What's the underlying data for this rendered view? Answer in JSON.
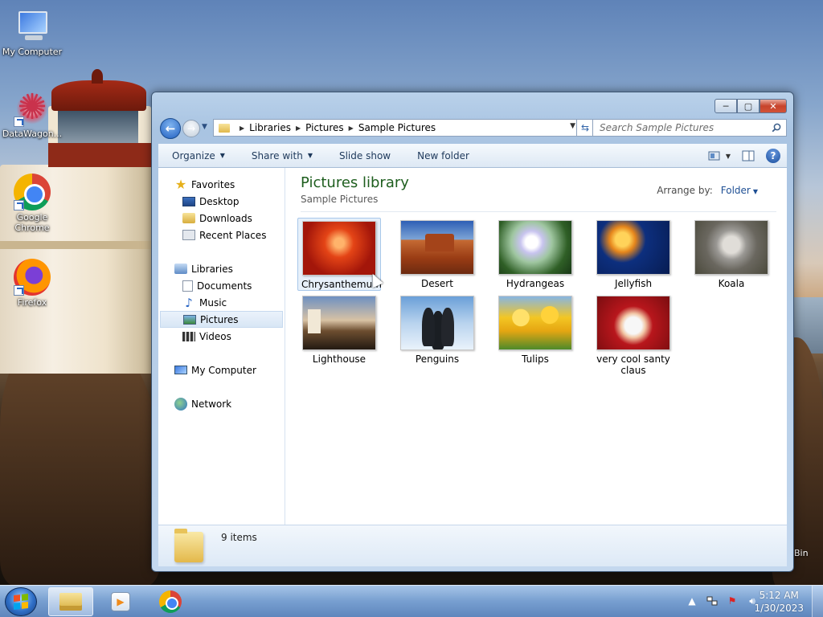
{
  "desktop": {
    "icons": [
      {
        "label": "My Computer",
        "icon": "computer-icon"
      },
      {
        "label": "DataWagon...",
        "icon": "datawagon-icon"
      },
      {
        "label": "Google Chrome",
        "icon": "chrome-icon"
      },
      {
        "label": "Firefox",
        "icon": "firefox-icon"
      }
    ],
    "partial_label": "Bin"
  },
  "window": {
    "controls": {
      "minimize": "─",
      "maximize": "▢",
      "close": "✕"
    },
    "address": {
      "crumbs": [
        "Libraries",
        "Pictures",
        "Sample Pictures"
      ]
    },
    "search": {
      "placeholder": "Search Sample Pictures"
    },
    "toolbar": {
      "organize": "Organize",
      "share_with": "Share with",
      "slide_show": "Slide show",
      "new_folder": "New folder"
    },
    "nav": {
      "favorites": "Favorites",
      "desktop": "Desktop",
      "downloads": "Downloads",
      "recent_places": "Recent Places",
      "libraries": "Libraries",
      "documents": "Documents",
      "music": "Music",
      "pictures": "Pictures",
      "videos": "Videos",
      "my_computer": "My Computer",
      "network": "Network"
    },
    "content": {
      "title": "Pictures library",
      "subtitle": "Sample Pictures",
      "arrange_label": "Arrange by:",
      "arrange_value": "Folder",
      "files": [
        {
          "name": "Chrysanthemum",
          "selected": true
        },
        {
          "name": "Desert"
        },
        {
          "name": "Hydrangeas"
        },
        {
          "name": "Jellyfish"
        },
        {
          "name": "Koala"
        },
        {
          "name": "Lighthouse"
        },
        {
          "name": "Penguins"
        },
        {
          "name": "Tulips"
        },
        {
          "name": "very cool santy claus"
        }
      ]
    },
    "details": {
      "count": "9 items"
    }
  },
  "taskbar": {
    "apps": [
      "Windows Explorer",
      "Windows Media Player",
      "Google Chrome"
    ],
    "clock": {
      "time": "5:12 AM",
      "date": "1/30/2023"
    },
    "tray": {
      "show_hidden": "▲"
    }
  }
}
